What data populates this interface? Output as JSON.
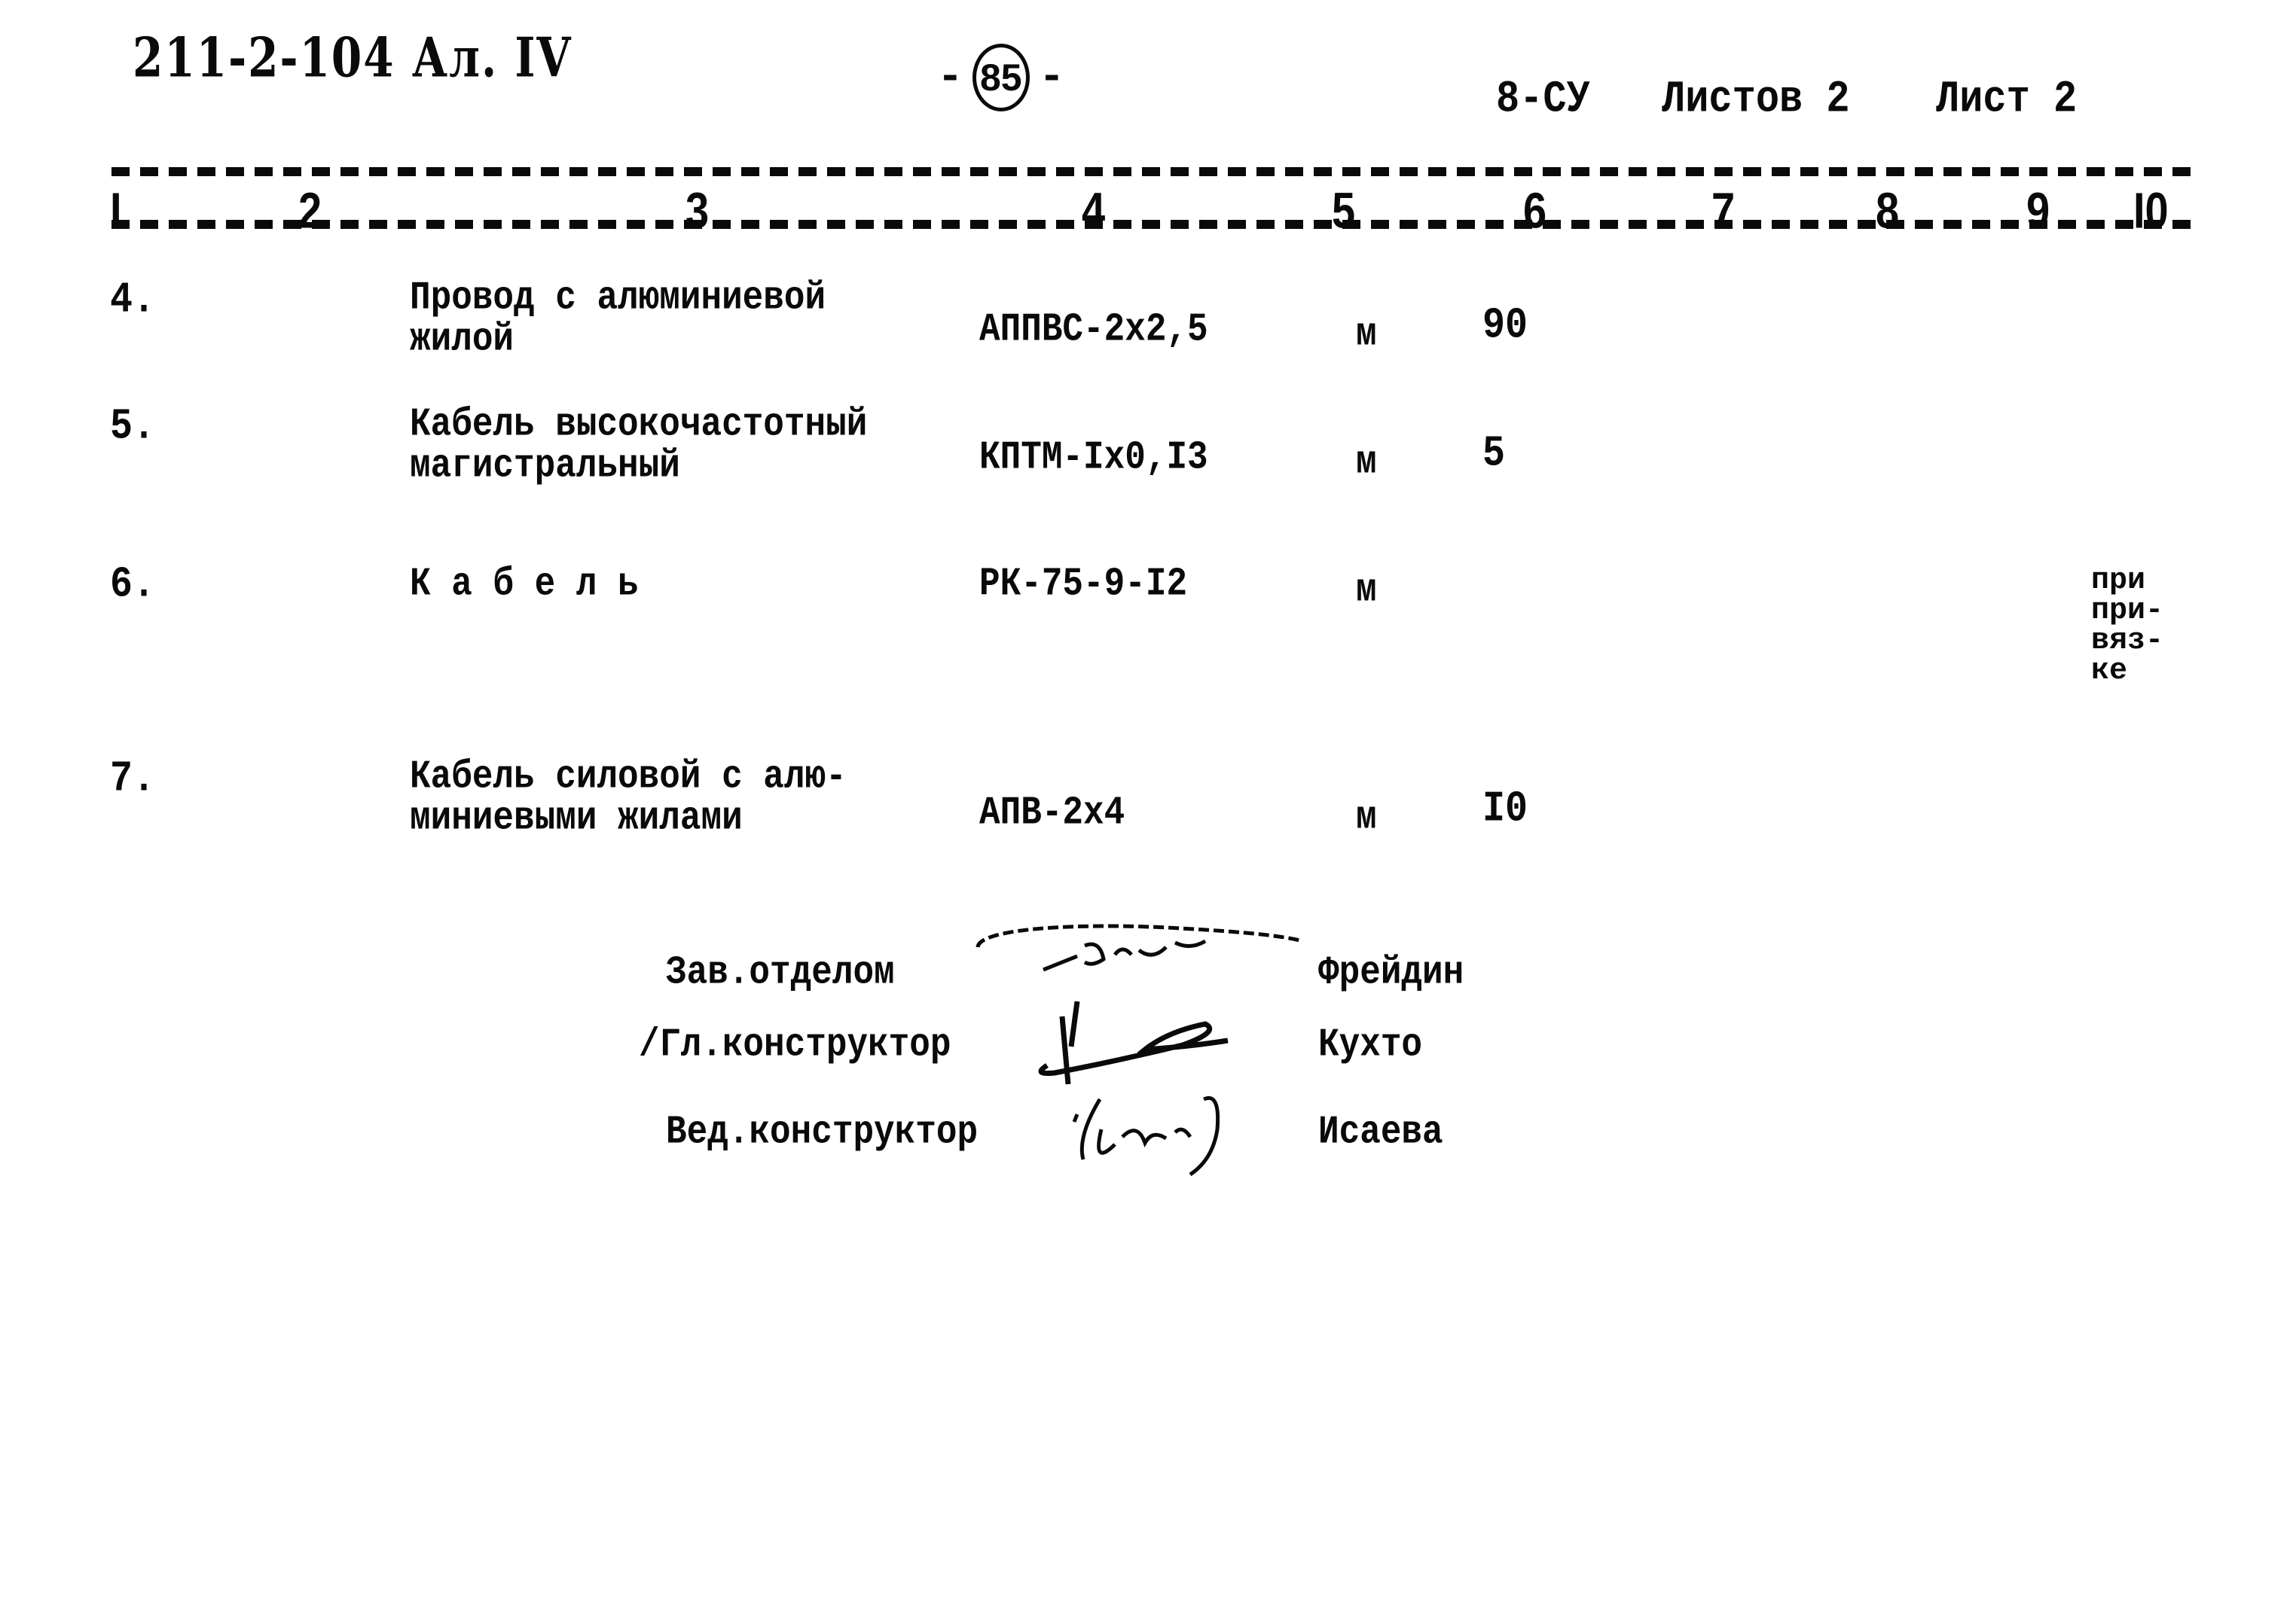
{
  "header": {
    "handwritten_ref": "211-2-104 Ал. IV",
    "page_number": "85",
    "sheet_code": "8-СУ",
    "sheets_total_label": "Листов 2",
    "sheet_label": "Лист 2"
  },
  "table": {
    "column_numbers": [
      "I",
      "2",
      "3",
      "4",
      "5",
      "6",
      "7",
      "8",
      "9",
      "I0"
    ],
    "rows": [
      {
        "pos": "4.",
        "name": "Провод с алюминиевой\nжилой",
        "type": "АППВС-2х2,5",
        "unit": "м",
        "qty": "90",
        "note": ""
      },
      {
        "pos": "5.",
        "name": "Кабель высокочастотный\nмагистральный",
        "type": "КПТМ-Iх0,I3",
        "unit": "м",
        "qty": "5",
        "note": ""
      },
      {
        "pos": "6.",
        "name": "К а б е л ь",
        "type": "РК-75-9-I2",
        "unit": "м",
        "qty": "",
        "note": "при\nпри-\nвяз-\nке"
      },
      {
        "pos": "7.",
        "name": "Кабель силовой с алю-\nминиевыми жилами",
        "type": "АПВ-2х4",
        "unit": "м",
        "qty": "I0",
        "note": ""
      }
    ]
  },
  "signatures": [
    {
      "role": "Зав.отделом",
      "name": "Фрейдин"
    },
    {
      "role": "Гл.конструктор",
      "name": "Кухто"
    },
    {
      "role": "Вед.конструктор",
      "name": "Исаева"
    }
  ]
}
